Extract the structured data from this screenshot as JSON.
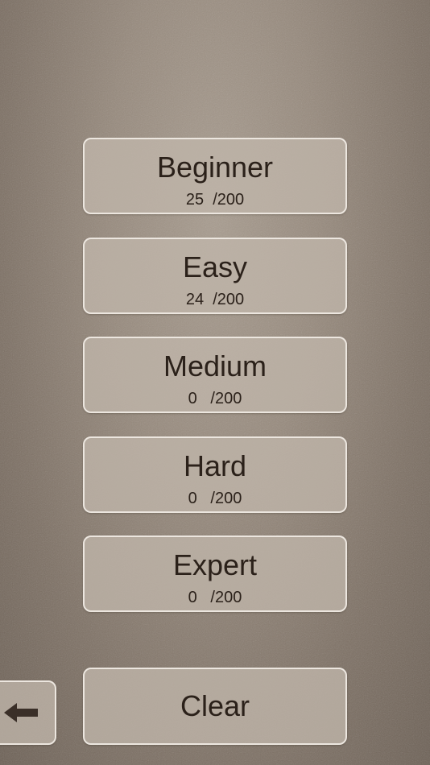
{
  "levels": [
    {
      "name": "Beginner",
      "score": "25  /200"
    },
    {
      "name": "Easy",
      "score": "24  /200"
    },
    {
      "name": "Medium",
      "score": "0   /200"
    },
    {
      "name": "Hard",
      "score": "0   /200"
    },
    {
      "name": "Expert",
      "score": "0   /200"
    }
  ],
  "clear_label": "Clear",
  "back_icon": "arrow-left-icon",
  "colors": {
    "background": "#978a7d",
    "button_fill": "#c0b6aa",
    "button_border": "#ece6df",
    "text": "#2b211a"
  }
}
